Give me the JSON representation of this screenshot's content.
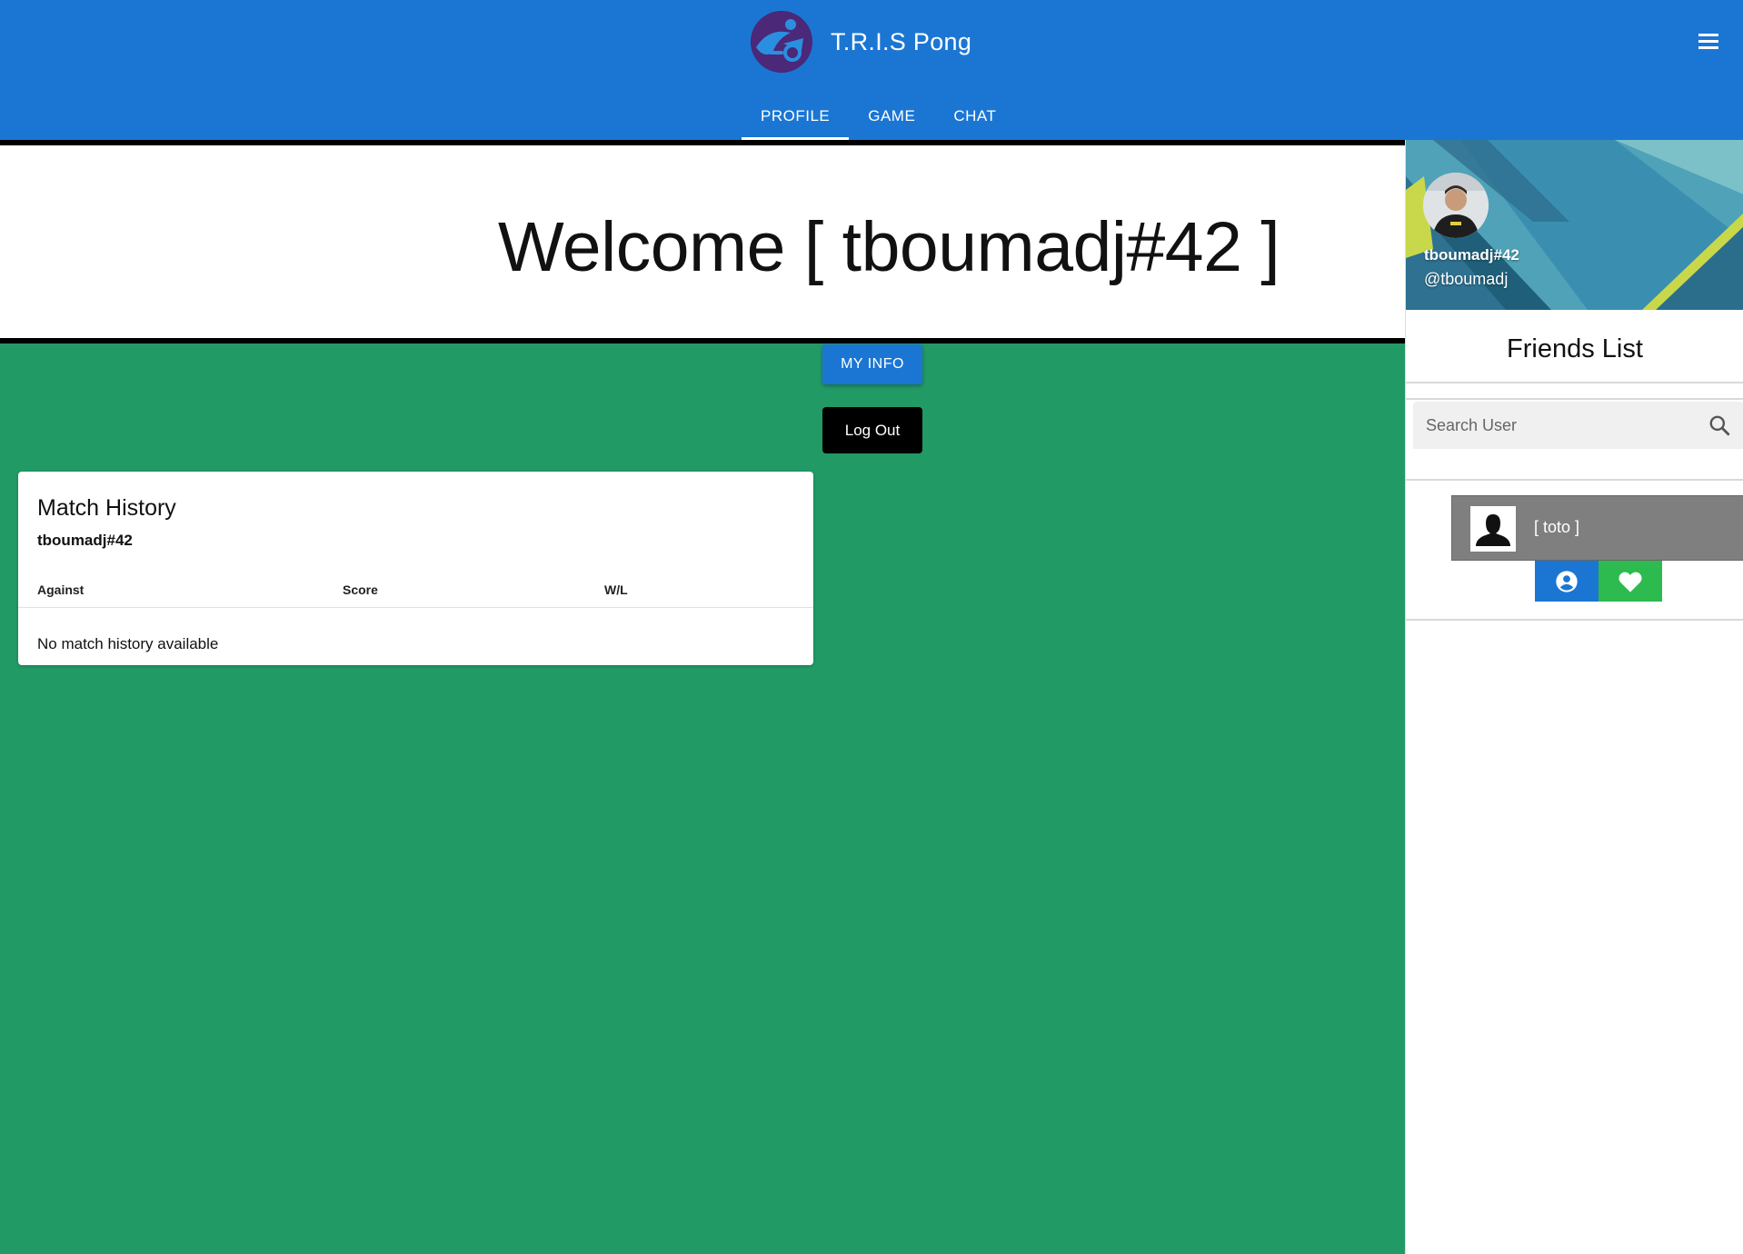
{
  "app": {
    "title": "T.R.I.S Pong"
  },
  "nav": {
    "tabs": [
      {
        "label": "PROFILE",
        "active": true
      },
      {
        "label": "GAME",
        "active": false
      },
      {
        "label": "CHAT",
        "active": false
      }
    ]
  },
  "main": {
    "welcome": "Welcome [ tboumadj#42 ]",
    "my_info_label": "MY INFO",
    "logout_label": "Log Out"
  },
  "match_history": {
    "title": "Match History",
    "username": "tboumadj#42",
    "columns": [
      "Against",
      "Score",
      "W/L"
    ],
    "empty_text": "No match history available"
  },
  "drawer": {
    "display_name": "tboumadj#42",
    "handle": "@tboumadj",
    "friends_title": "Friends List",
    "search": {
      "placeholder": "Search User"
    },
    "friends": [
      {
        "name": "[ toto ]"
      }
    ]
  },
  "colors": {
    "primary": "#1b76d3",
    "page_background": "#229a66",
    "favorite": "#2dba4e",
    "friend_card": "#7f7f7f"
  },
  "icons": {
    "menu": "menu-icon",
    "search": "search-icon",
    "profile": "account-circle-icon",
    "favorite": "heart-icon"
  }
}
